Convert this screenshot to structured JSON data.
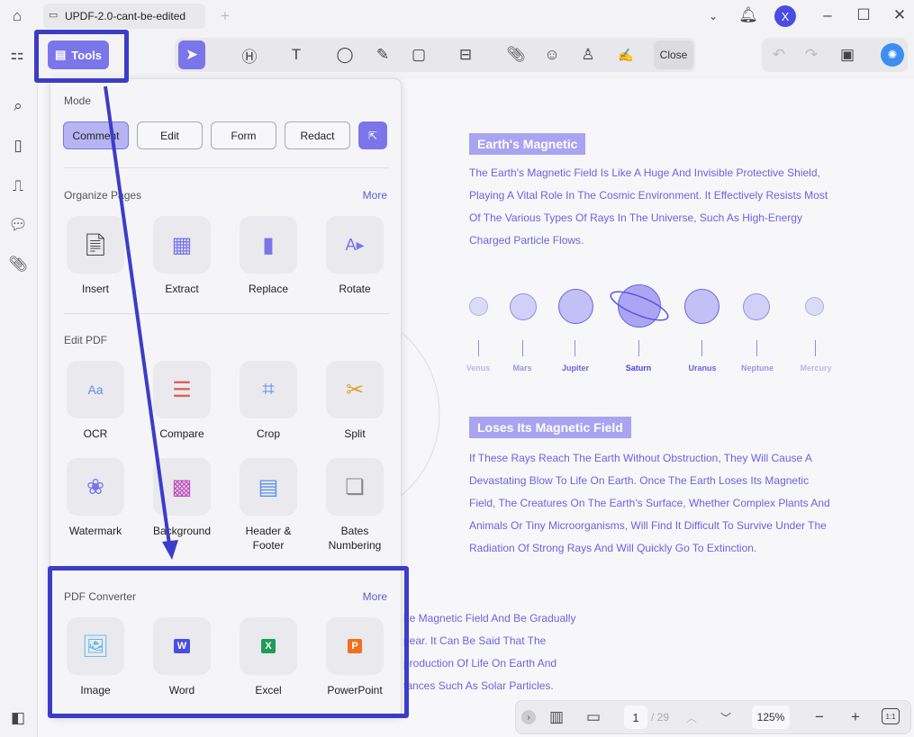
{
  "window": {
    "tab_title": "UPDF-2.0-cant-be-edited",
    "avatar_letter": "X",
    "accent": "#3b3dc9"
  },
  "toolbar": {
    "tools_label": "Tools",
    "close_label": "Close"
  },
  "panel": {
    "mode_label": "Mode",
    "modes": [
      "Comment",
      "Edit",
      "Form",
      "Redact"
    ],
    "organize": {
      "label": "Organize Pages",
      "more": "More",
      "items": [
        "Insert",
        "Extract",
        "Replace",
        "Rotate"
      ]
    },
    "edit": {
      "label": "Edit PDF",
      "items": [
        "OCR",
        "Compare",
        "Crop",
        "Split",
        "Watermark",
        "Background",
        "Header & Footer",
        "Bates Numbering"
      ]
    },
    "converter": {
      "label": "PDF Converter",
      "more": "More",
      "items": [
        "Image",
        "Word",
        "Excel",
        "PowerPoint"
      ]
    }
  },
  "document": {
    "heading1": "Earth's Magnetic",
    "para1": [
      "The Earth's Magnetic Field Is Like A Huge And Invisible Protective Shield,",
      "Playing A Vital Role In The Cosmic Environment. It Effectively Resists Most",
      "Of The Various Types Of Rays In The Universe, Such As High-Energy",
      "Charged Particle Flows."
    ],
    "planets": [
      "Venus",
      "Mars",
      "Jupiter",
      "Saturn",
      "Uranus",
      "Neptune",
      "Mercury"
    ],
    "heading2": "Loses Its Magnetic Field",
    "para2": [
      "If These Rays Reach The Earth Without Obstruction, They Will Cause A",
      "Devastating Blow To Life On Earth. Once The Earth Loses Its Magnetic",
      "Field, The Creatures On The Earth's Surface, Whether Complex Plants And",
      "Animals Or Tiny Microorganisms, Will Find It Difficult To Survive Under The",
      "Radiation Of Strong Rays And Will Quickly Go To Extinction."
    ],
    "para3": [
      "he Magnetic Field And Be Gradually",
      "pear. It Can Be Said That The",
      "production Of Life On Earth And",
      "tances Such As Solar Particles."
    ]
  },
  "bottombar": {
    "page": "1",
    "total": "/ 29",
    "zoom": "125%"
  }
}
